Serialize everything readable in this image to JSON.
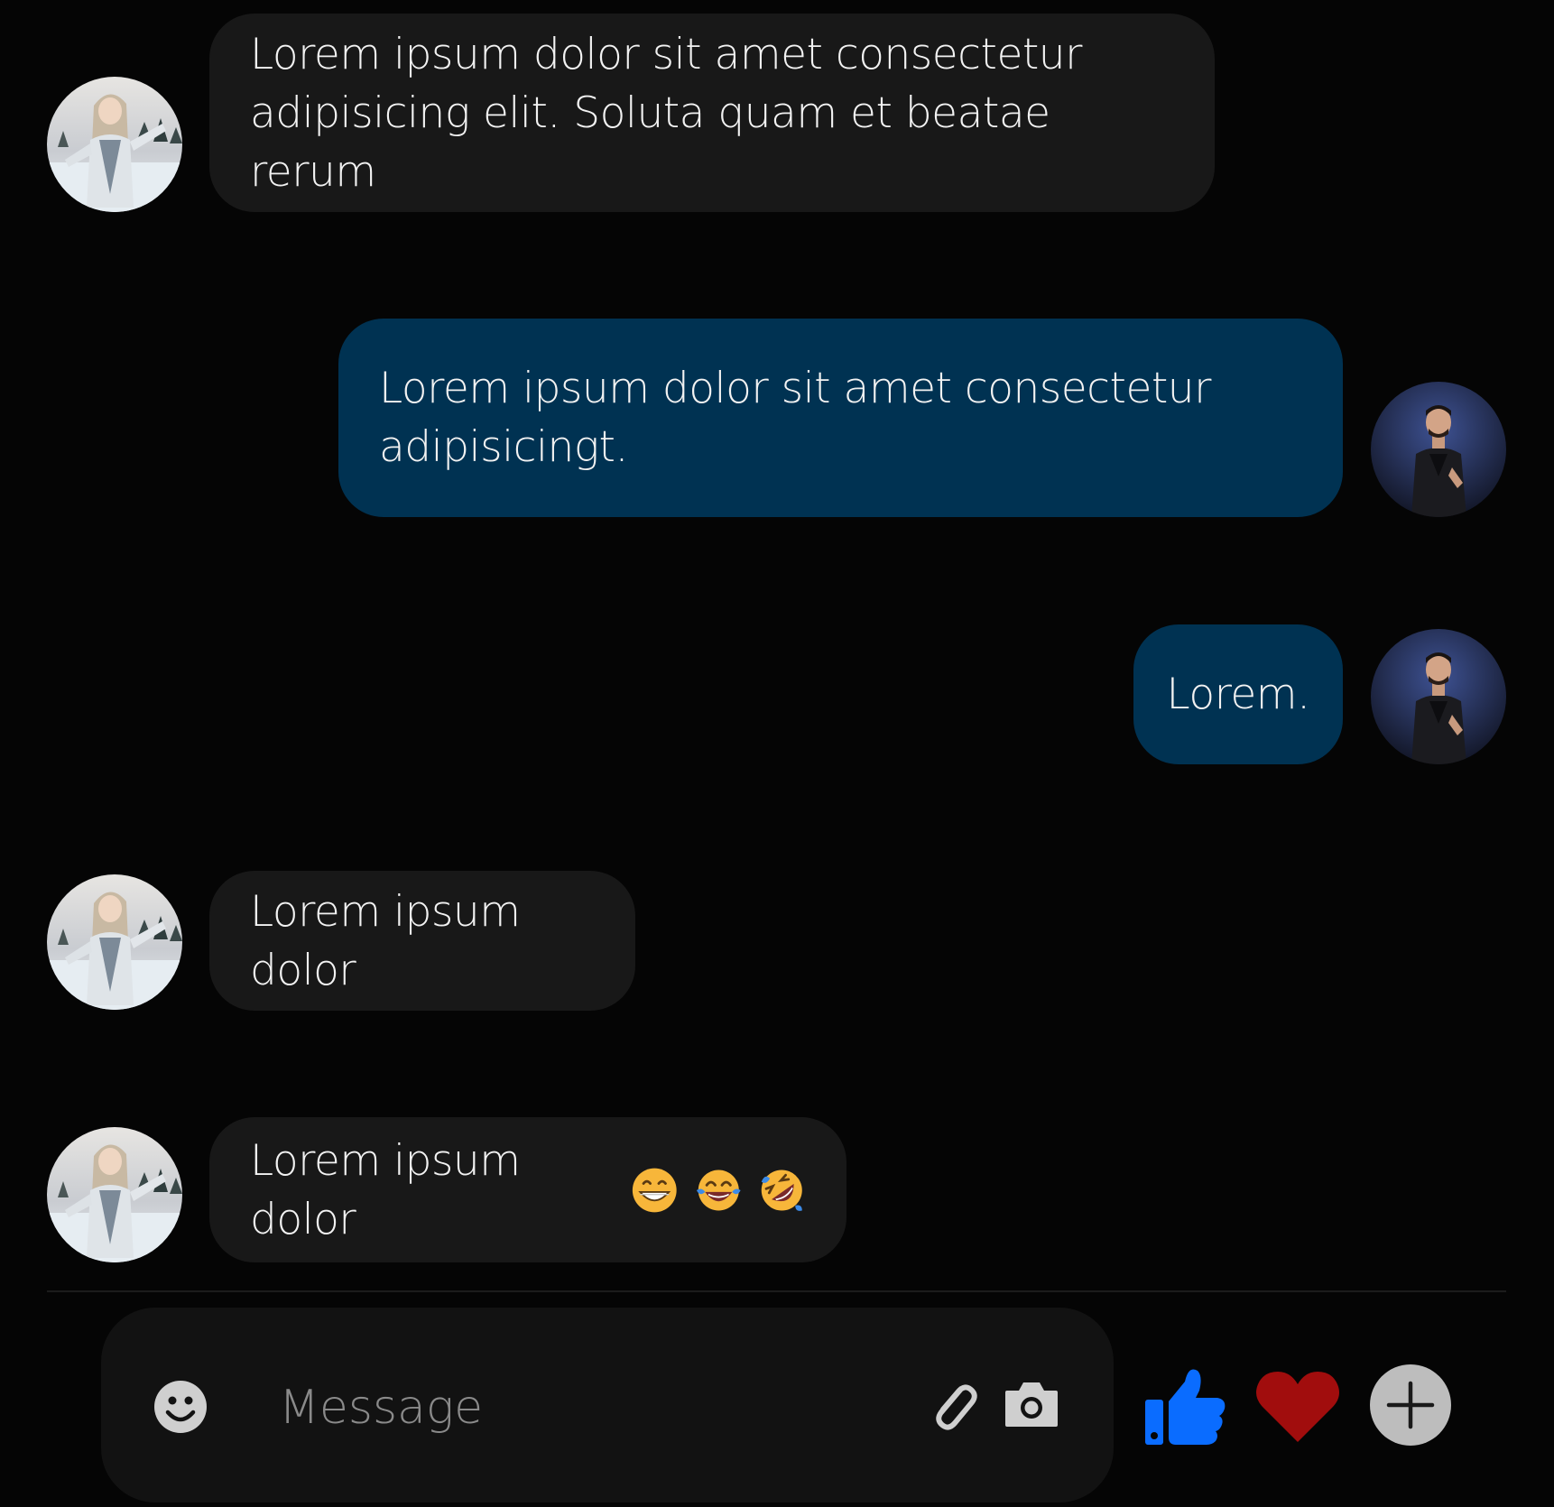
{
  "conversation": {
    "messages": [
      {
        "direction": "incoming",
        "text_line1": "Lorem ipsum dolor sit amet consectetur",
        "text_line2": "adipisicing elit. Soluta quam et beatae rerum"
      },
      {
        "direction": "outgoing",
        "text_line1": "Lorem ipsum dolor sit amet consectetur",
        "text_line2": "adipisicingt."
      },
      {
        "direction": "outgoing",
        "text": "Lorem."
      },
      {
        "direction": "incoming",
        "text": "Lorem ipsum dolor"
      },
      {
        "direction": "incoming",
        "text": "Lorem ipsum dolor",
        "emojis": [
          "grinning-face-icon",
          "tears-of-joy-icon",
          "rolling-on-floor-laughing-icon"
        ]
      }
    ]
  },
  "composer": {
    "placeholder": "Message",
    "value": ""
  },
  "icons": {
    "emoji_button": "smiley-icon",
    "attach_button": "paperclip-icon",
    "camera_button": "camera-icon",
    "like_button": "thumbs-up-icon",
    "love_button": "heart-icon",
    "add_button": "plus-circle-icon"
  },
  "colors": {
    "background": "#050505",
    "incoming_bubble": "#181818",
    "outgoing_bubble": "#003252",
    "composer": "#121212",
    "like": "#0a6cff",
    "heart": "#a10d0d",
    "add": "#bdbdbd"
  }
}
